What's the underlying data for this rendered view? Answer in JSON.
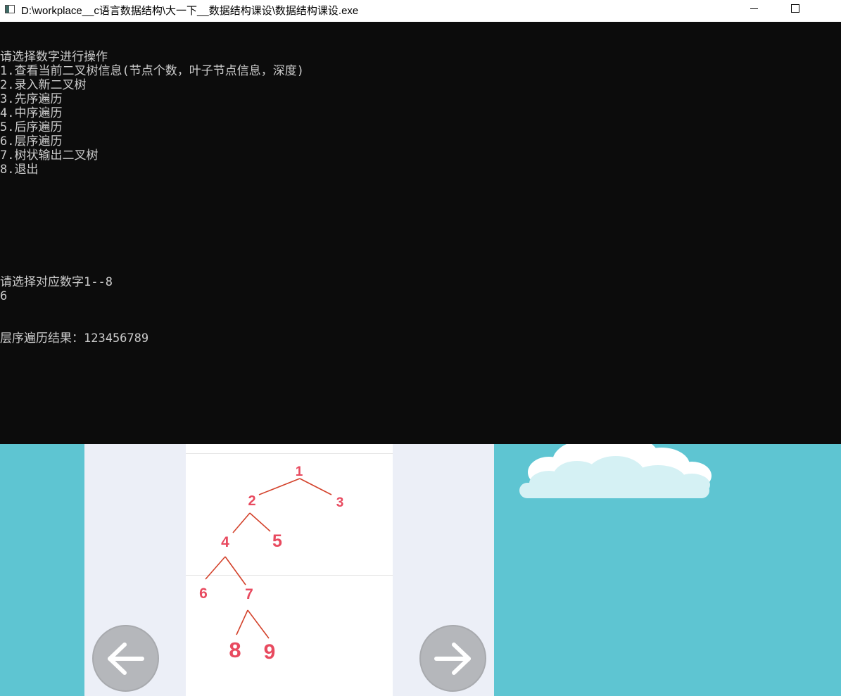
{
  "window": {
    "title": "D:\\workplace__c语言数据结构\\大一下__数据结构课设\\数据结构课设.exe"
  },
  "console": {
    "lines": [
      "请选择数字进行操作",
      "1.查看当前二叉树信息(节点个数，叶子节点信息，深度)",
      "2.录入新二叉树",
      "3.先序遍历",
      "4.中序遍历",
      "5.后序遍历",
      "6.层序遍历",
      "7.树状输出二叉树",
      "8.退出"
    ],
    "prompt": "请选择对应数字1--8",
    "input_value": "6",
    "result": "层序遍历结果：123456789"
  },
  "tree": {
    "nodes": [
      "1",
      "2",
      "3",
      "4",
      "5",
      "6",
      "7",
      "8",
      "9"
    ],
    "color": "#e84a5f"
  },
  "colors": {
    "console_bg": "#0c0c0c",
    "console_text": "#cccccc",
    "background": "#5ec5d2",
    "nav_button": "#b5b7bb"
  },
  "icons": {
    "prev": "arrow-left-icon",
    "next": "arrow-right-icon",
    "app": "console-app-icon"
  }
}
